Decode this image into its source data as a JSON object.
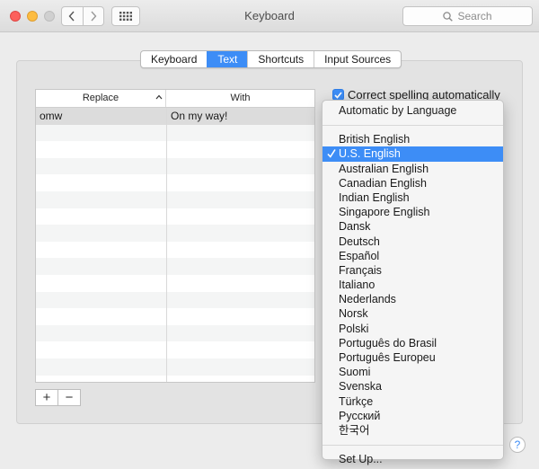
{
  "window": {
    "title": "Keyboard"
  },
  "search": {
    "placeholder": "Search"
  },
  "tabs": [
    {
      "label": "Keyboard",
      "active": false
    },
    {
      "label": "Text",
      "active": true
    },
    {
      "label": "Shortcuts",
      "active": false
    },
    {
      "label": "Input Sources",
      "active": false
    }
  ],
  "table": {
    "columns": {
      "replace": "Replace",
      "with": "With"
    },
    "rows": [
      {
        "replace": "omw",
        "with": "On my way!"
      }
    ],
    "empty_rows": 15
  },
  "table_controls": {
    "add": "+",
    "remove": "−"
  },
  "spelling_checkbox": {
    "label": "Correct spelling automatically",
    "checked": true
  },
  "language_menu": {
    "top_item": "Automatic by Language",
    "selected": "U.S. English",
    "items": [
      "British English",
      "U.S. English",
      "Australian English",
      "Canadian English",
      "Indian English",
      "Singapore English",
      "Dansk",
      "Deutsch",
      "Español",
      "Français",
      "Italiano",
      "Nederlands",
      "Norsk",
      "Polski",
      "Português do Brasil",
      "Português Europeu",
      "Suomi",
      "Svenska",
      "Türkçe",
      "Русский",
      "한국어"
    ],
    "bottom_item": "Set Up..."
  },
  "help": {
    "label": "?"
  },
  "colors": {
    "accent": "#3d8df6",
    "panel": "#e3e3e3",
    "window": "#ececec"
  },
  "icons": [
    "chevron-left-icon",
    "chevron-right-icon",
    "grid-icon",
    "search-icon",
    "sort-up-icon",
    "checkmark-icon"
  ]
}
